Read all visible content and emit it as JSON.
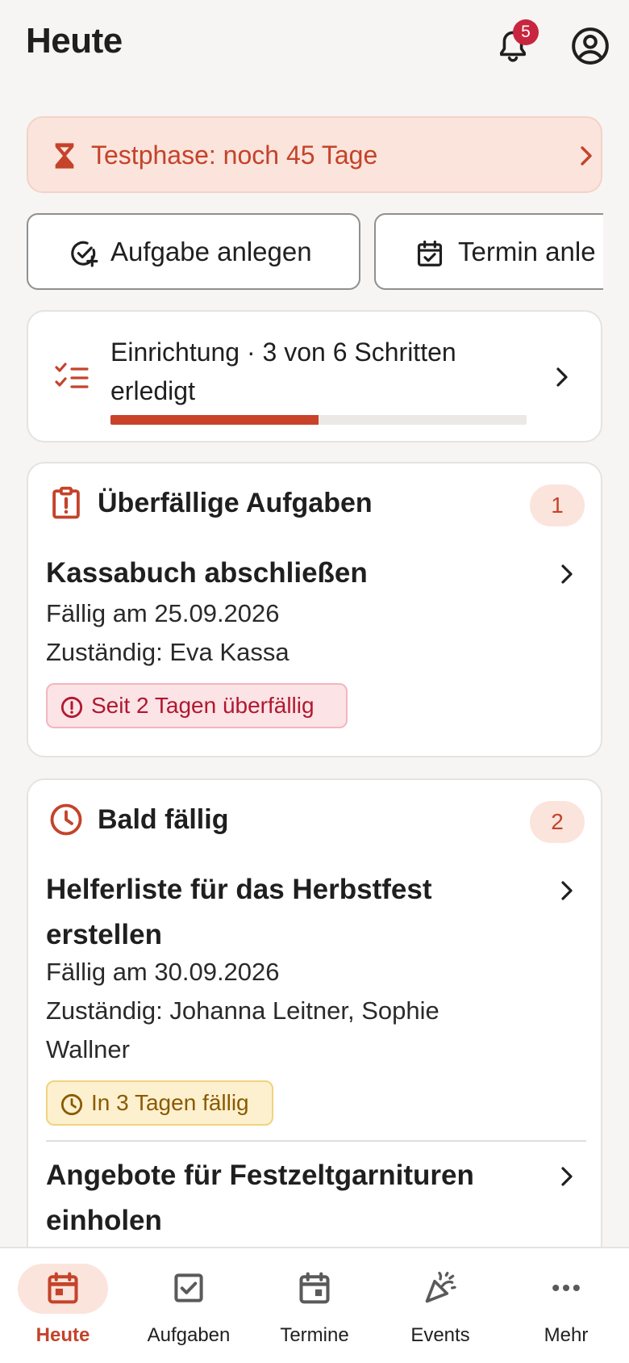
{
  "header": {
    "title": "Heute",
    "notification_count": "5",
    "notification_icon": "bell-icon",
    "account_icon": "account-circle-icon"
  },
  "trial_banner": {
    "text": "Testphase: noch 45 Tage",
    "icon": "hourglass-icon"
  },
  "actions": [
    {
      "label": "Aufgabe anlegen",
      "icon": "add-task-icon"
    },
    {
      "label": "Termin anle",
      "icon": "calendar-check-icon"
    }
  ],
  "setup": {
    "text": "Einrichtung · 3 von 6 Schritten erledigt",
    "steps_done": 3,
    "steps_total": 6,
    "icon": "checklist-icon"
  },
  "overdue": {
    "title": "Überfällige Aufgaben",
    "count": "1",
    "icon": "clipboard-alert-icon",
    "tasks": [
      {
        "title": "Kassabuch abschließen",
        "due": "Fällig am 25.09.2026",
        "assignee": "Zuständig: Eva Kassa",
        "status": "Seit 2 Tagen überfällig"
      }
    ]
  },
  "soon": {
    "title": "Bald fällig",
    "count": "2",
    "icon": "clock-icon",
    "tasks": [
      {
        "title": "Helferliste für das Herbstfest erstellen",
        "due": "Fällig am 30.09.2026",
        "assignee": "Zuständig: Johanna Leitner, Sophie Wallner",
        "status": "In 3 Tagen fällig"
      },
      {
        "title": "Angebote für Festzeltgarnituren einholen"
      }
    ]
  },
  "nav": {
    "items": [
      {
        "label": "Heute",
        "icon": "calendar-today-icon",
        "active": true
      },
      {
        "label": "Aufgaben",
        "icon": "checkbox-icon"
      },
      {
        "label": "Termine",
        "icon": "calendar-icon"
      },
      {
        "label": "Events",
        "icon": "party-popper-icon"
      },
      {
        "label": "Mehr",
        "icon": "more-dots-icon"
      }
    ]
  },
  "colors": {
    "accent": "#c4432a",
    "accent_soft": "#fbe4dc",
    "badge": "#c8253f",
    "overdue_pill": "#fbe3e6",
    "soon_pill": "#fdf0cf"
  }
}
